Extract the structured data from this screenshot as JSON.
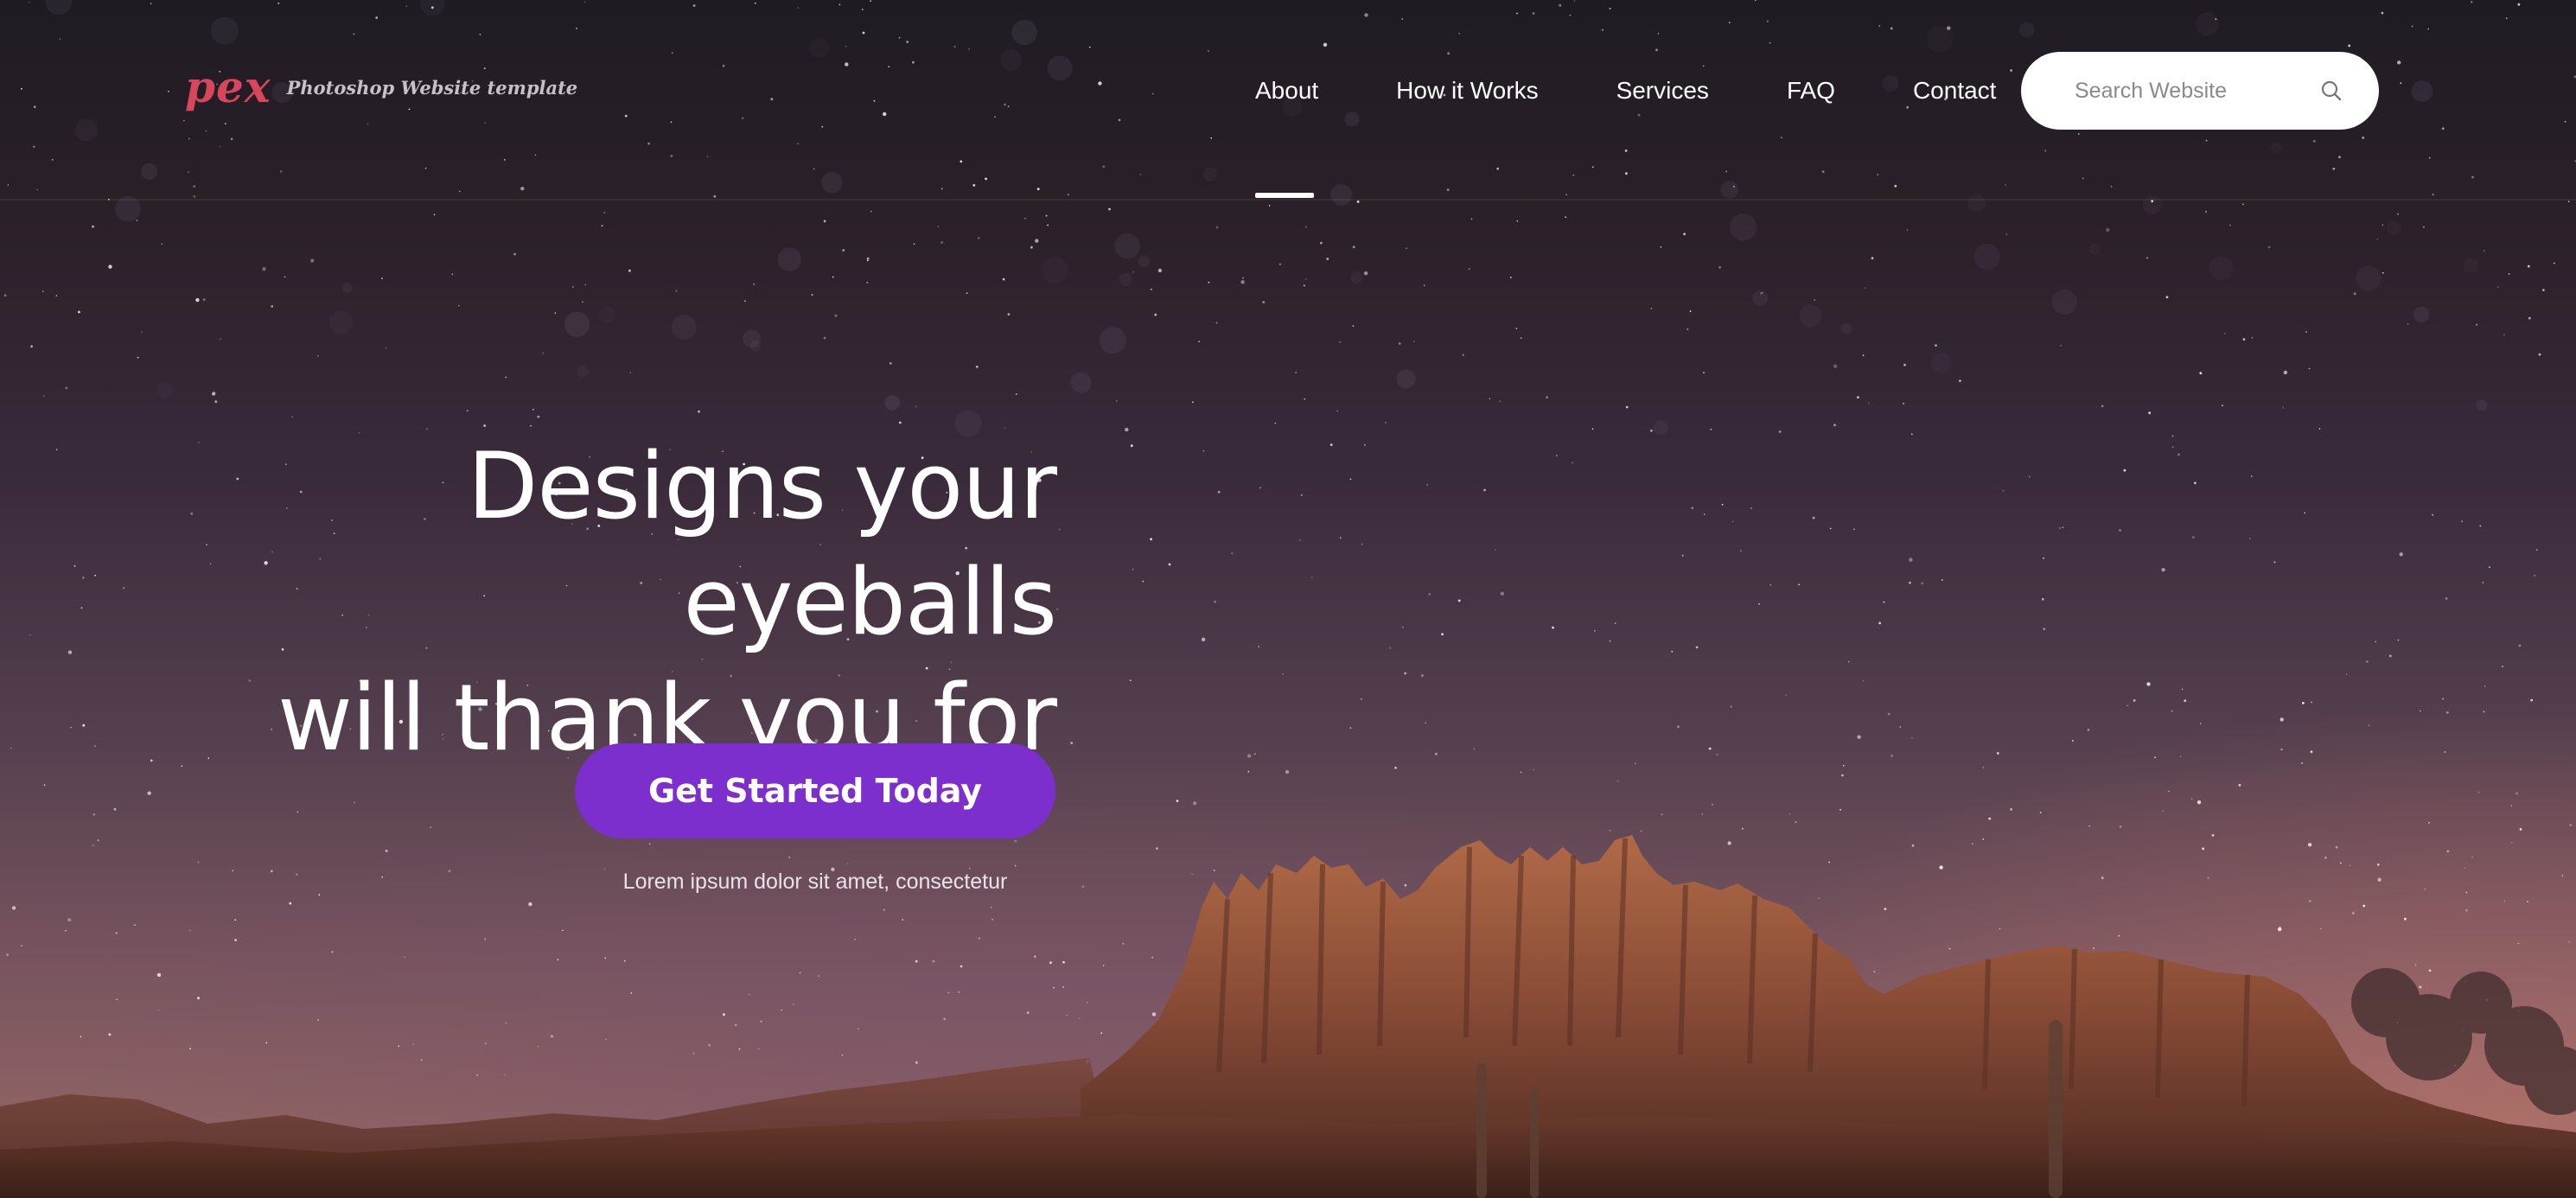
{
  "brand": {
    "logo_text": "pex",
    "tagline": "Photoshop Website template"
  },
  "nav": {
    "items": [
      {
        "label": "About",
        "active": true
      },
      {
        "label": "How it Works"
      },
      {
        "label": "Services"
      },
      {
        "label": "FAQ"
      },
      {
        "label": "Contact"
      }
    ]
  },
  "search": {
    "placeholder": "Search Website",
    "icon": "search-icon"
  },
  "hero": {
    "title_line1": "Designs your eyeballs",
    "title_line2": "will thank you for",
    "cta_label": "Get Started Today",
    "cta_subtext": "Lorem ipsum dolor sit amet, consectetur"
  },
  "colors": {
    "accent": "#7c2fcc",
    "logo": "#d8465c",
    "text": "#ffffff"
  }
}
